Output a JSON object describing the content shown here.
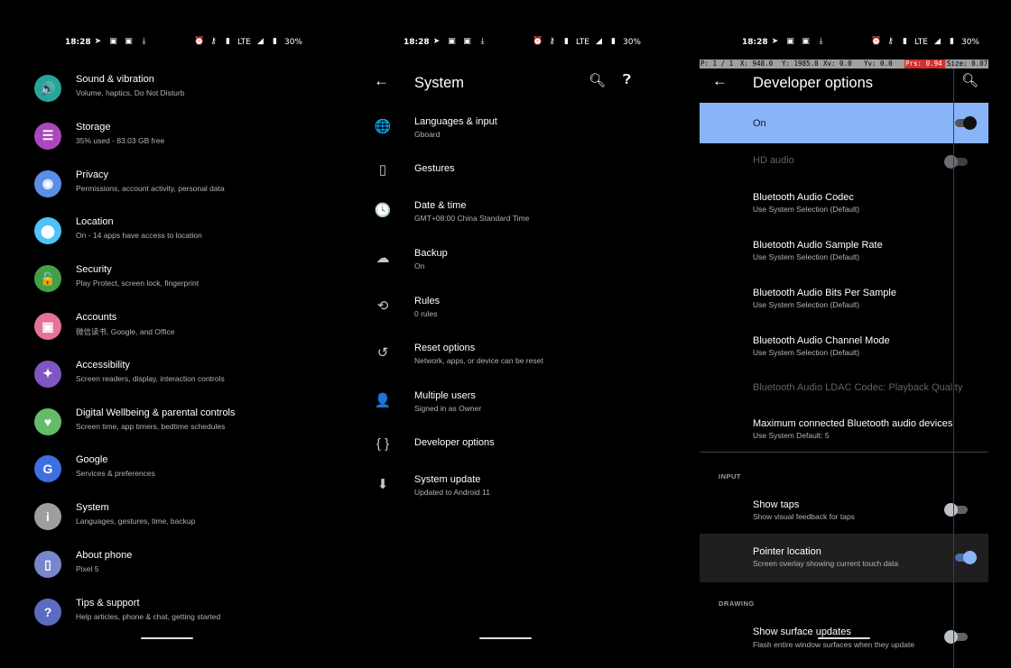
{
  "status": {
    "time": "18:28",
    "network": "LTE",
    "battery": "30%"
  },
  "settings_list": [
    {
      "title": "Sound & vibration",
      "subtitle": "Volume, haptics, Do Not Disturb",
      "icon": "volume-icon",
      "color": "#26a69a",
      "glyph": "🔊"
    },
    {
      "title": "Storage",
      "subtitle": "35% used - 83.03 GB free",
      "icon": "storage-icon",
      "color": "#ab47bc",
      "glyph": "☰"
    },
    {
      "title": "Privacy",
      "subtitle": "Permissions, account activity, personal data",
      "icon": "privacy-icon",
      "color": "#5c8ee6",
      "glyph": "◉"
    },
    {
      "title": "Location",
      "subtitle": "On - 14 apps have access to location",
      "icon": "location-icon",
      "color": "#4fc3f7",
      "glyph": "⬤"
    },
    {
      "title": "Security",
      "subtitle": "Play Protect, screen lock, fingerprint",
      "icon": "lock-icon",
      "color": "#43a047",
      "glyph": "🔓"
    },
    {
      "title": "Accounts",
      "subtitle": "微信读书, Google, and Office",
      "icon": "accounts-icon",
      "color": "#e57399",
      "glyph": "▣"
    },
    {
      "title": "Accessibility",
      "subtitle": "Screen readers, display, interaction controls",
      "icon": "accessibility-icon",
      "color": "#7e57c2",
      "glyph": "✦"
    },
    {
      "title": "Digital Wellbeing & parental controls",
      "subtitle": "Screen time, app timers, bedtime schedules",
      "icon": "wellbeing-icon",
      "color": "#66bb6a",
      "glyph": "♥"
    },
    {
      "title": "Google",
      "subtitle": "Services & preferences",
      "icon": "google-icon",
      "color": "#3d6fe0",
      "glyph": "G"
    },
    {
      "title": "System",
      "subtitle": "Languages, gestures, time, backup",
      "icon": "info-icon",
      "color": "#9e9e9e",
      "glyph": "i"
    },
    {
      "title": "About phone",
      "subtitle": "Pixel 5",
      "icon": "phone-icon",
      "color": "#7986cb",
      "glyph": "▯"
    },
    {
      "title": "Tips & support",
      "subtitle": "Help articles, phone & chat, getting started",
      "icon": "help-icon",
      "color": "#5c6bc0",
      "glyph": "?"
    }
  ],
  "system": {
    "title": "System",
    "items": [
      {
        "title": "Languages & input",
        "subtitle": "Gboard",
        "icon": "globe-icon",
        "glyph": "🌐"
      },
      {
        "title": "Gestures",
        "subtitle": "",
        "icon": "gestures-icon",
        "glyph": "▯"
      },
      {
        "title": "Date & time",
        "subtitle": "GMT+08:00 China Standard Time",
        "icon": "clock-icon",
        "glyph": "🕓"
      },
      {
        "title": "Backup",
        "subtitle": "On",
        "icon": "cloud-upload-icon",
        "glyph": "☁"
      },
      {
        "title": "Rules",
        "subtitle": "0 rules",
        "icon": "rules-icon",
        "glyph": "⟲"
      },
      {
        "title": "Reset options",
        "subtitle": "Network, apps, or device can be reset",
        "icon": "history-icon",
        "glyph": "↺"
      },
      {
        "title": "Multiple users",
        "subtitle": "Signed in as Owner",
        "icon": "person-icon",
        "glyph": "👤"
      },
      {
        "title": "Developer options",
        "subtitle": "",
        "icon": "braces-icon",
        "glyph": "{ }"
      },
      {
        "title": "System update",
        "subtitle": "Updated to Android 11",
        "icon": "system-update-icon",
        "glyph": "⬇"
      }
    ]
  },
  "developer": {
    "title": "Developer options",
    "pointer_bar": {
      "p": "P: 1 / 1",
      "x": "X: 948.0",
      "y": "Y: 1985.0",
      "xv": "Xv: 0.0",
      "yv": "Yv: 0.0",
      "prs": "Prs: 0.94",
      "size": "Size: 0.07"
    },
    "on_label": "On",
    "hd_audio": "HD audio",
    "items": [
      {
        "title": "Bluetooth Audio Codec",
        "subtitle": "Use System Selection (Default)"
      },
      {
        "title": "Bluetooth Audio Sample Rate",
        "subtitle": "Use System Selection (Default)"
      },
      {
        "title": "Bluetooth Audio Bits Per Sample",
        "subtitle": "Use System Selection (Default)"
      },
      {
        "title": "Bluetooth Audio Channel Mode",
        "subtitle": "Use System Selection (Default)"
      }
    ],
    "ldac": "Bluetooth Audio LDAC Codec: Playback Quality",
    "max_devices": {
      "title": "Maximum connected Bluetooth audio devices",
      "subtitle": "Use System Default: 5"
    },
    "input_section": "INPUT",
    "show_taps": {
      "title": "Show taps",
      "subtitle": "Show visual feedback for taps"
    },
    "pointer_location": {
      "title": "Pointer location",
      "subtitle": "Screen overlay showing current touch data"
    },
    "drawing_section": "DRAWING",
    "surface_updates": {
      "title": "Show surface updates",
      "subtitle": "Flash entire window surfaces when they update"
    }
  }
}
